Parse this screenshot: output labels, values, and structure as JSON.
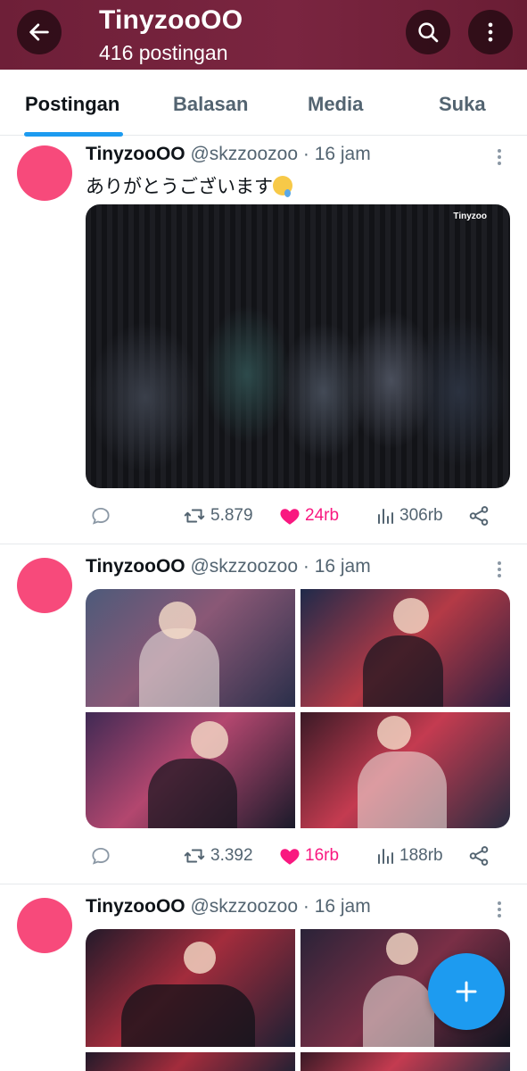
{
  "header": {
    "title": "TinyzooOO",
    "subtitle": "416 postingan",
    "background": "#6e1f38"
  },
  "tabs": [
    {
      "label": "Postingan",
      "active": true
    },
    {
      "label": "Balasan",
      "active": false
    },
    {
      "label": "Media",
      "active": false
    },
    {
      "label": "Suka",
      "active": false
    }
  ],
  "posts": [
    {
      "name": "TinyzooOO",
      "handle": "@skzzoozoo",
      "time": "16 jam",
      "text": "ありがとうございます",
      "text_emoji": "face-holding-back-tears-emoji",
      "media_watermark": "Tinyzoo",
      "replies": "",
      "reposts": "5.879",
      "likes": "24rb",
      "views": "306rb"
    },
    {
      "name": "TinyzooOO",
      "handle": "@skzzoozoo",
      "time": "16 jam",
      "text": "",
      "replies": "",
      "reposts": "3.392",
      "likes": "16rb",
      "views": "188rb"
    },
    {
      "name": "TinyzooOO",
      "handle": "@skzzoozoo",
      "time": "16 jam",
      "text": ""
    }
  ],
  "colors": {
    "accent": "#1d9bf0",
    "like": "#f91880",
    "avatar": "#f74a7b",
    "muted": "#536471"
  },
  "icons": {
    "back": "arrow-left-icon",
    "search": "search-icon",
    "more": "more-vertical-icon",
    "reply": "reply-icon",
    "repost": "repost-icon",
    "like": "heart-icon",
    "views": "views-icon",
    "share": "share-icon",
    "compose": "plus-icon"
  }
}
